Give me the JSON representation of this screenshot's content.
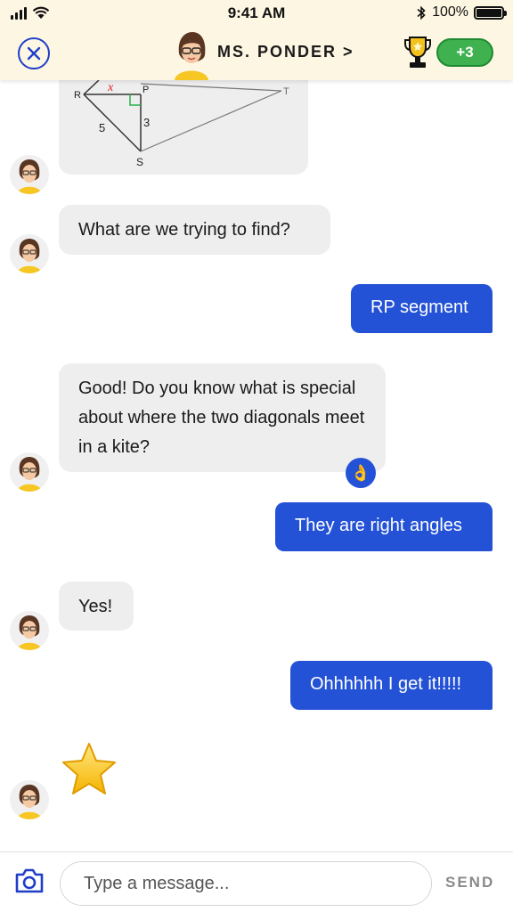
{
  "status_bar": {
    "time": "9:41 AM",
    "battery": "100%",
    "icons": [
      "signal-icon",
      "wifi-icon",
      "bluetooth-icon",
      "battery-icon"
    ]
  },
  "header": {
    "title": "MS. PONDER >",
    "points": "+3",
    "icons": [
      "close-icon",
      "trophy-icon"
    ]
  },
  "diagram": {
    "labels": {
      "r": "R",
      "p": "P",
      "t": "T",
      "s": "S",
      "x": "x",
      "rs": "5",
      "ps": "3"
    }
  },
  "messages": [
    {
      "from": "tutor",
      "text": "What are we trying to find?"
    },
    {
      "from": "student",
      "text": "RP segment"
    },
    {
      "from": "tutor",
      "text": "Good! Do you know what is special about where the two diagonals meet in a kite?"
    },
    {
      "from": "student",
      "text": "They are right angles"
    },
    {
      "from": "tutor",
      "text": "Yes!"
    },
    {
      "from": "student",
      "text": "Ohhhhhh I get it!!!!!"
    }
  ],
  "reaction_emoji": "👌",
  "input": {
    "placeholder": "Type a message...",
    "value": "",
    "send_label": "SEND"
  },
  "colors": {
    "header_bg": "#fdf6e3",
    "accent_blue": "#2452d6",
    "badge_green": "#3fb24f",
    "bubble_gray": "#eeeeee"
  }
}
